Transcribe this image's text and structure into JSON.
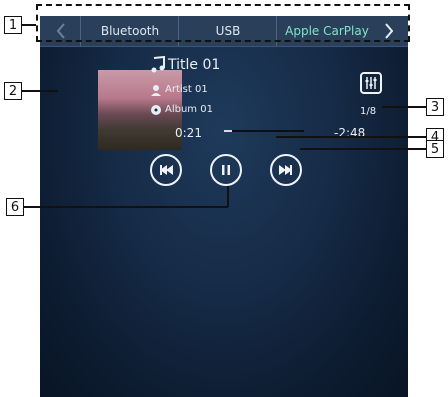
{
  "callouts": [
    "1",
    "2",
    "3",
    "4",
    "5",
    "6"
  ],
  "tabs": [
    {
      "label": "Bluetooth"
    },
    {
      "label": "USB"
    },
    {
      "label": "Apple CarPlay"
    }
  ],
  "track": {
    "title": "Title 01",
    "artist": "Artist 01",
    "album": "Album 01",
    "index": "1/8",
    "elapsed": "0:21",
    "remaining": "-2:48",
    "progress_fraction": 0.1
  },
  "icons": {
    "nav_left": "chevron-left-icon",
    "nav_right": "chevron-right-icon",
    "music": "music-note-icon",
    "artist": "artist-icon",
    "album": "album-icon",
    "prev": "previous-track-icon",
    "pause": "pause-icon",
    "next": "next-track-icon",
    "settings": "sound-settings-icon"
  }
}
